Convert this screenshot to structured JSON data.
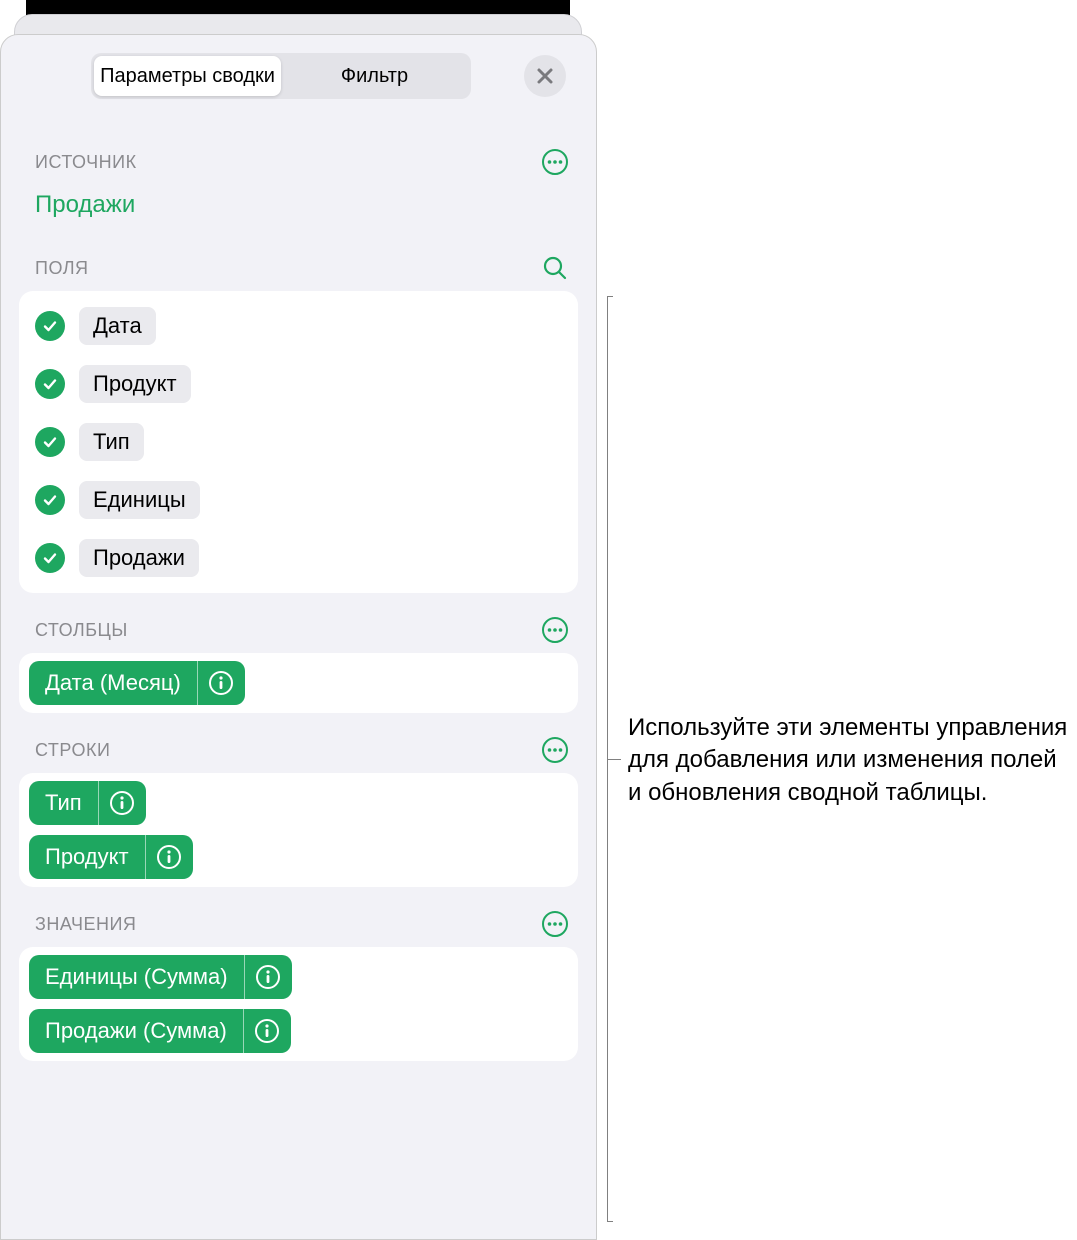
{
  "tabs": {
    "pivot": "Параметры сводки",
    "filter": "Фильтр"
  },
  "sections": {
    "source": "Источник",
    "fields": "Поля",
    "columns": "Столбцы",
    "rows": "Строки",
    "values": "Значения"
  },
  "source_name": "Продажи",
  "fields": [
    {
      "label": "Дата"
    },
    {
      "label": "Продукт"
    },
    {
      "label": "Тип"
    },
    {
      "label": "Единицы"
    },
    {
      "label": "Продажи"
    }
  ],
  "columns": [
    {
      "label": "Дата (Месяц)"
    }
  ],
  "rows": [
    {
      "label": "Тип"
    },
    {
      "label": "Продукт"
    }
  ],
  "values": [
    {
      "label": "Единицы (Сумма)"
    },
    {
      "label": "Продажи (Сумма)"
    }
  ],
  "callout": "Используйте эти элементы управления для добавления или изменения полей и обновления сводной таблицы."
}
